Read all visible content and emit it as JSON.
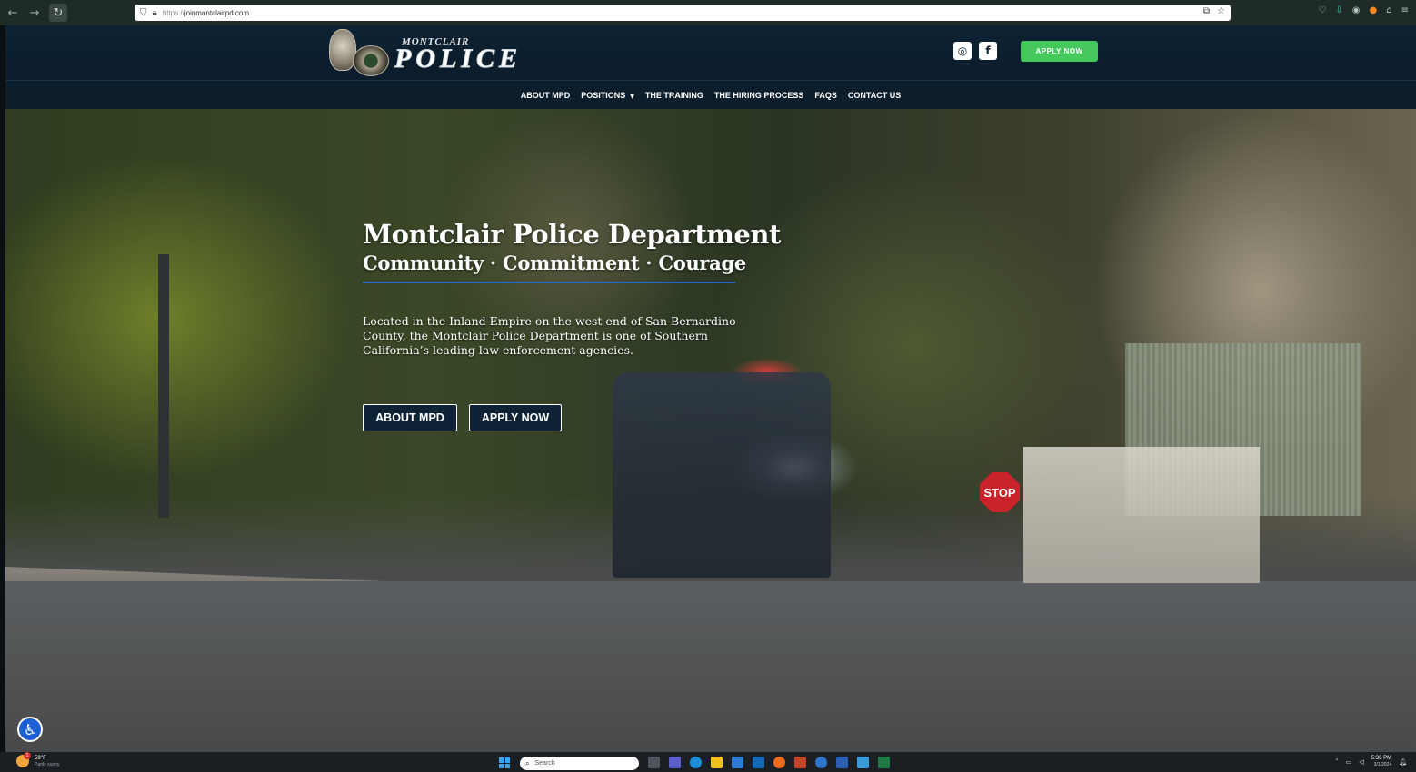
{
  "browser": {
    "url_protocol": "https://",
    "url_host": "joinmontclairpd.com",
    "icons": [
      "back-icon",
      "forward-icon",
      "reload-icon",
      "shield-icon",
      "lock-icon",
      "translate-icon",
      "bookmark-star-icon",
      "pocket-icon",
      "download-icon",
      "account-icon",
      "extension-icon",
      "puzzle-icon",
      "menu-icon"
    ]
  },
  "header": {
    "logo_small": "MONTCLAIR",
    "logo_big": "POLICE",
    "instagram_glyph": "◎",
    "facebook_glyph": "f",
    "apply_label": "APPLY NOW",
    "apply_color": "#45c95d",
    "bg_color": "#0d2233"
  },
  "nav": {
    "items": [
      {
        "label": "ABOUT MPD"
      },
      {
        "label": "POSITIONS",
        "has_dropdown": true
      },
      {
        "label": "THE TRAINING"
      },
      {
        "label": "THE HIRING PROCESS"
      },
      {
        "label": "FAQS"
      },
      {
        "label": "CONTACT US"
      }
    ]
  },
  "hero": {
    "title": "Montclair Police Department",
    "subtitle": "Community · Commitment · Courage",
    "description": "Located in the Inland Empire on the west end of San Bernardino County, the Montclair Police Department is one of Southern California’s leading law enforcement agencies.",
    "about_button": "ABOUT MPD",
    "apply_button": "APPLY NOW",
    "stop_sign_text": "STOP",
    "rule_color": "#2a66b5"
  },
  "accessibility": {
    "icon": "accessibility-icon",
    "color": "#1f5fd6"
  },
  "taskbar": {
    "weather_temp": "59°F",
    "weather_condition": "Partly sunny",
    "weather_badge": "1",
    "search_placeholder": "Search",
    "time": "5:36 PM",
    "date": "3/1/2024"
  }
}
